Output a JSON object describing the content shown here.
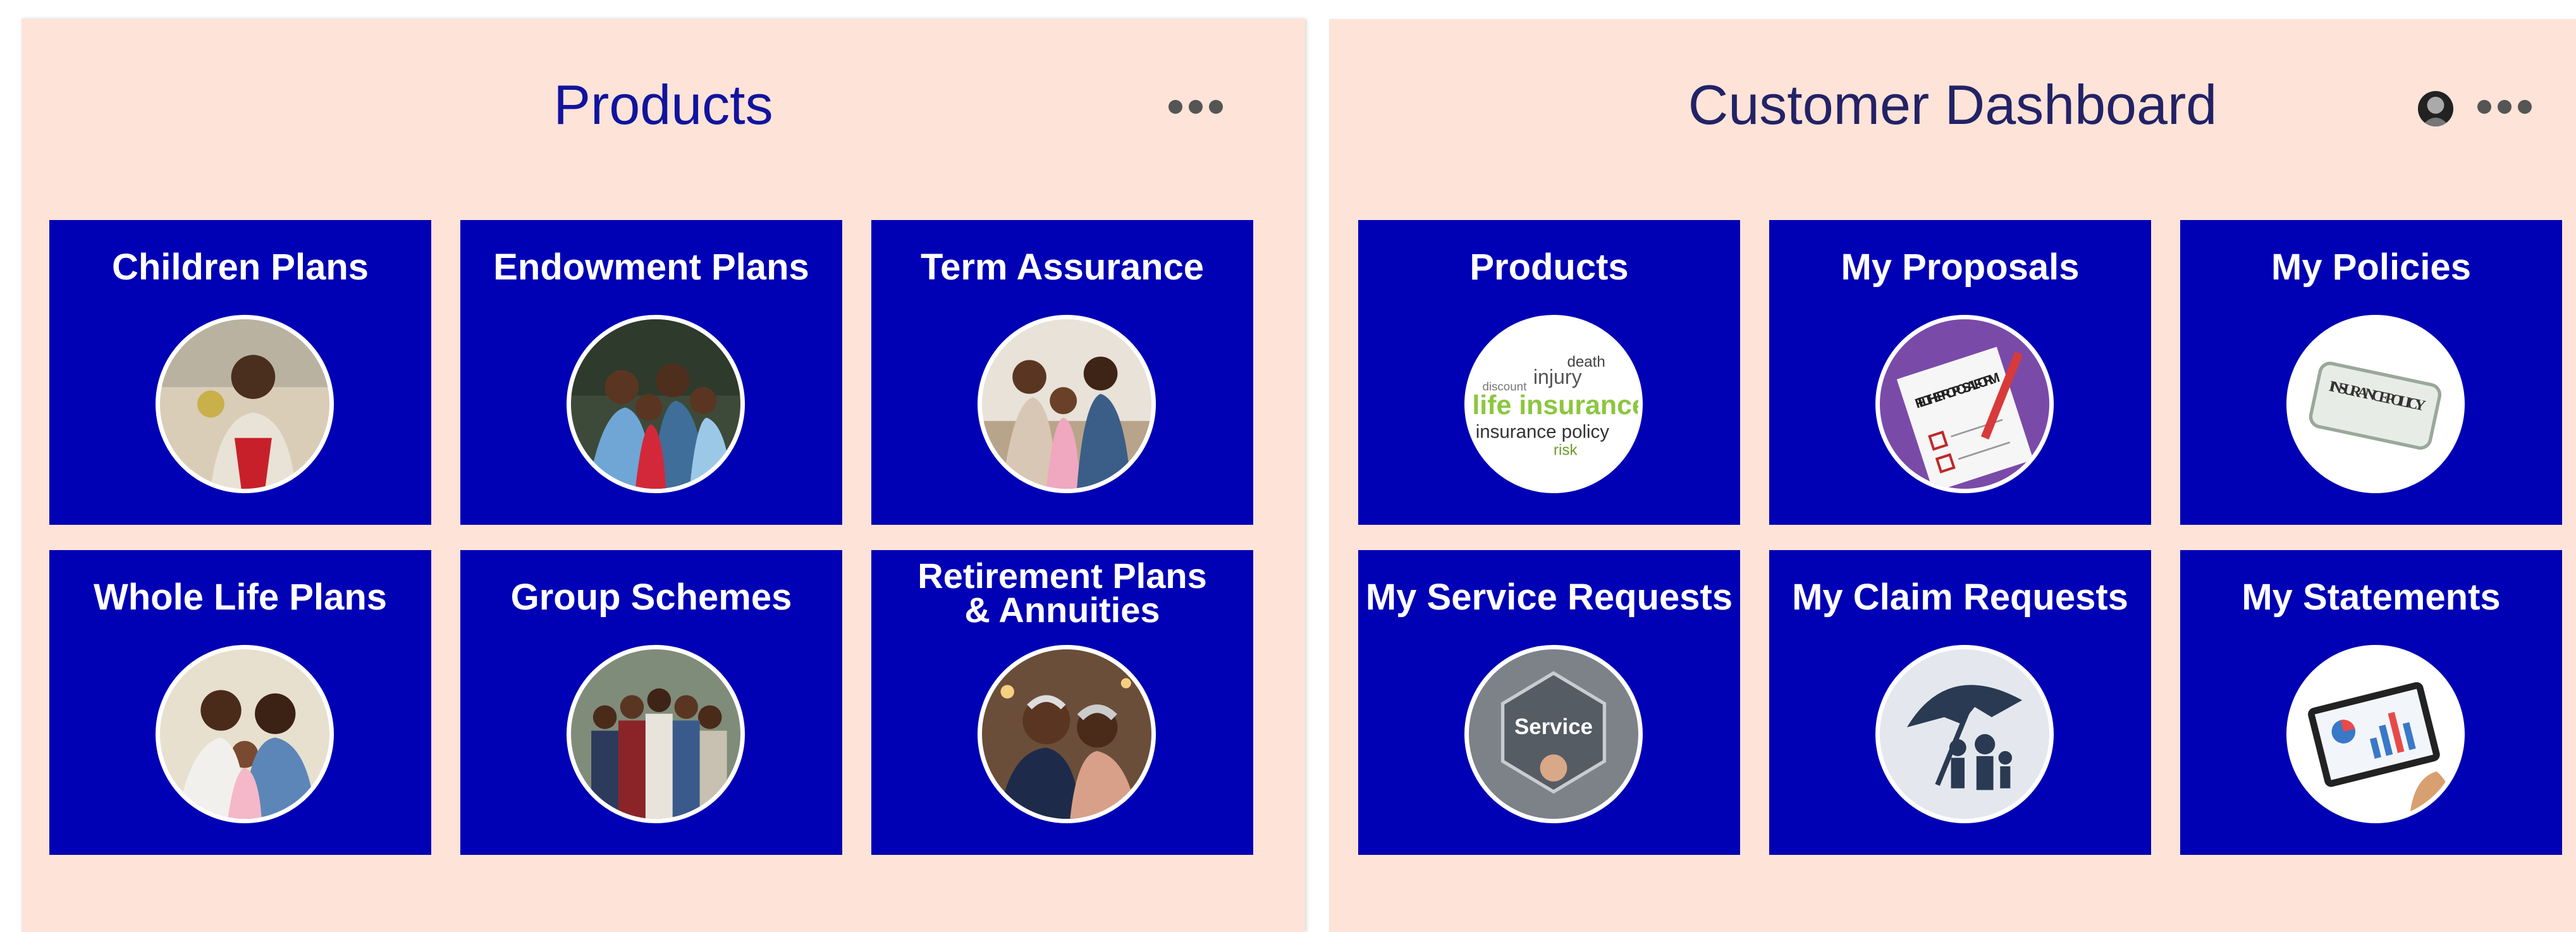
{
  "products_panel": {
    "title": "Products",
    "tiles": [
      {
        "label": "Children Plans",
        "icon": "child-photo-icon"
      },
      {
        "label": "Endowment Plans",
        "icon": "family-photo-icon"
      },
      {
        "label": "Term Assurance",
        "icon": "family-couch-photo-icon"
      },
      {
        "label": "Whole Life Plans",
        "icon": "family-baby-photo-icon"
      },
      {
        "label": "Group Schemes",
        "icon": "group-photo-icon"
      },
      {
        "label": "Retirement Plans & Annuities",
        "line1": "Retirement Plans",
        "line2": "& Annuities",
        "icon": "elderly-couple-photo-icon"
      }
    ]
  },
  "dashboard_panel": {
    "title": "Customer Dashboard",
    "tiles": [
      {
        "label": "Products",
        "icon": "word-cloud-icon",
        "words": [
          "death",
          "injury",
          "life insurance",
          "insurance policy",
          "risk",
          "discount"
        ]
      },
      {
        "label": "My Proposals",
        "icon": "proposal-form-icon",
        "form_text": "FILL THE PROPOSAL FORM"
      },
      {
        "label": "My Policies",
        "icon": "insurance-policy-scroll-icon",
        "scroll_text": "INSURANCE POLICY"
      },
      {
        "label": "My Service Requests",
        "icon": "service-hexagon-icon",
        "badge_text": "Service"
      },
      {
        "label": "My Claim Requests",
        "icon": "umbrella-family-icon"
      },
      {
        "label": "My Statements",
        "icon": "tablet-chart-icon"
      }
    ]
  },
  "colors": {
    "panel_bg": "#fee3d8",
    "tile_bg": "#0000b4",
    "tile_text": "#ffffff",
    "products_title": "#10149e",
    "dashboard_title": "#222266"
  }
}
